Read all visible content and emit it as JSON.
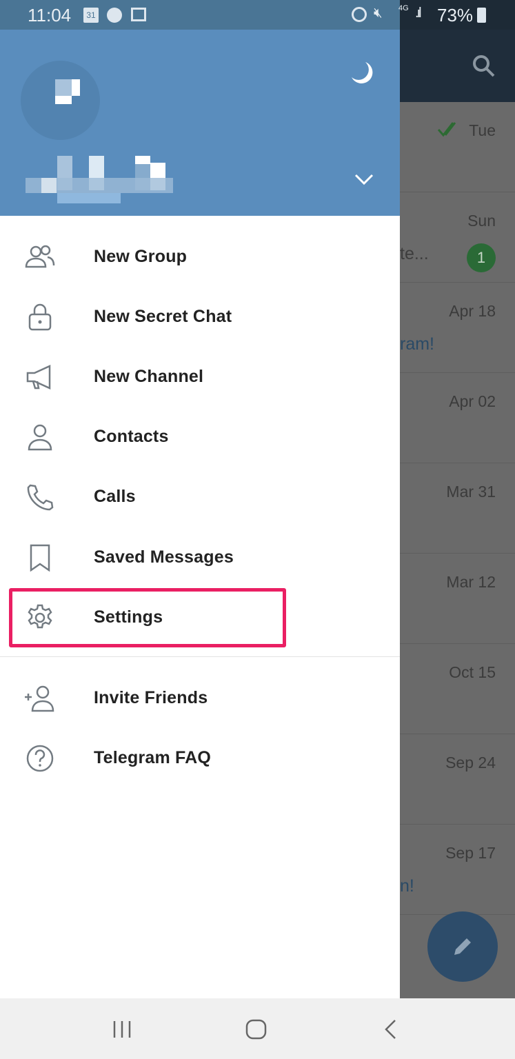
{
  "status_bar": {
    "time": "11:04",
    "calendar_day": "31",
    "battery": "73%",
    "network": "4G",
    "icons": [
      "calendar-icon",
      "messenger-icon",
      "gallery-icon",
      "alarm-icon",
      "mute-icon",
      "network-icon",
      "signal-icon",
      "battery-icon"
    ]
  },
  "drawer": {
    "header_color": "#5a8dbd",
    "icons": [
      "night-mode-moon-icon",
      "expand-accounts-chevron-icon"
    ],
    "items": [
      {
        "label": "New Group",
        "icon": "group-icon"
      },
      {
        "label": "New Secret Chat",
        "icon": "lock-icon"
      },
      {
        "label": "New Channel",
        "icon": "megaphone-icon"
      },
      {
        "label": "Contacts",
        "icon": "person-icon"
      },
      {
        "label": "Calls",
        "icon": "phone-icon"
      },
      {
        "label": "Saved Messages",
        "icon": "bookmark-icon"
      },
      {
        "label": "Settings",
        "icon": "gear-icon",
        "highlighted": true
      }
    ],
    "extra_items": [
      {
        "label": "Invite Friends",
        "icon": "add-person-icon"
      },
      {
        "label": "Telegram FAQ",
        "icon": "help-icon"
      }
    ],
    "highlight_color": "#ea1f63"
  },
  "chat_list": {
    "rows": [
      {
        "date": "Tue",
        "read": true,
        "snippet": ""
      },
      {
        "date": "Sun",
        "snippet": "te...",
        "unread": "1"
      },
      {
        "date": "Apr 18",
        "snippet": "ram!"
      },
      {
        "date": "Apr 02",
        "snippet": ""
      },
      {
        "date": "Mar 31",
        "snippet": ""
      },
      {
        "date": "Mar 12",
        "snippet": ""
      },
      {
        "date": "Oct 15",
        "snippet": ""
      },
      {
        "date": "Sep 24",
        "snippet": ""
      },
      {
        "date": "Sep 17",
        "snippet": "n!"
      }
    ]
  }
}
